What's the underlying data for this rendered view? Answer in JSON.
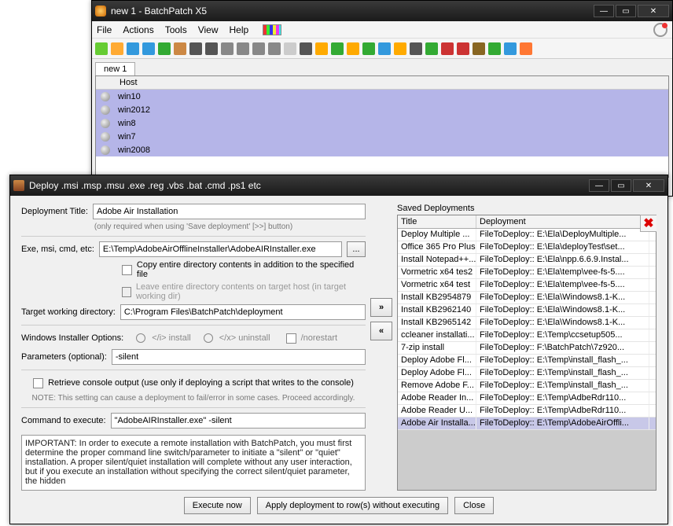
{
  "w1": {
    "title": "new 1 - BatchPatch X5",
    "menu": [
      "File",
      "Actions",
      "Tools",
      "View",
      "Help"
    ],
    "tab": "new 1",
    "gridHeader": "Host",
    "rows": [
      "win10",
      "win2012",
      "win8",
      "win7",
      "win2008"
    ]
  },
  "w2": {
    "title": "Deploy .msi .msp .msu .exe .reg .vbs .bat .cmd .ps1 etc",
    "labels": {
      "depTitle": "Deployment Title:",
      "hint1": "(only required when using 'Save deployment' [>>] button)",
      "exe": "Exe, msi, cmd, etc:",
      "copyDir": "Copy entire directory contents in addition to the specified file",
      "leaveDir": "Leave entire directory contents on target host (in target working dir)",
      "twd": "Target working directory:",
      "wio": "Windows Installer Options:",
      "optInstall": "</i> install",
      "optUninstall": "</x> uninstall",
      "optNorestart": "/norestart",
      "params": "Parameters (optional):",
      "retrieve": "Retrieve console output (use only if deploying a script that writes to the console)",
      "note2": "NOTE: This setting can cause a deployment to fail/error in some cases.  Proceed accordingly.",
      "cmd": "Command to execute:",
      "saved": "Saved Deployments",
      "thTitle": "Title",
      "thDep": "Deployment",
      "execNow": "Execute now",
      "applyRows": "Apply deployment to row(s) without executing",
      "close": "Close",
      "browse": "..."
    },
    "values": {
      "depTitle": "Adobe Air Installation",
      "exe": "E:\\Temp\\AdobeAirOfflineInstaller\\AdobeAIRInstaller.exe",
      "twd": "C:\\Program Files\\BatchPatch\\deployment",
      "params": "-silent",
      "cmd": "\"AdobeAIRInstaller.exe\" -silent"
    },
    "notes": "IMPORTANT: In order to execute a remote installation with BatchPatch, you must first determine the proper command line switch/parameter to initiate a \"silent\" or \"quiet\" installation.\n\nA proper silent/quiet installation will complete without any user interaction, but if you execute an installation without specifying the correct silent/quiet parameter, the hidden",
    "saved": [
      {
        "t": "Deploy Multiple ...",
        "d": "FileToDeploy:: E:\\Ela\\DeployMultiple..."
      },
      {
        "t": "Office 365 Pro Plus",
        "d": "FileToDeploy:: E:\\Ela\\deployTest\\set..."
      },
      {
        "t": "Install Notepad++...",
        "d": "FileToDeploy:: E:\\Ela\\npp.6.6.9.Instal..."
      },
      {
        "t": "Vormetric x64 tes2",
        "d": "FileToDeploy:: E:\\Ela\\temp\\vee-fs-5...."
      },
      {
        "t": "Vormetric x64 test",
        "d": "FileToDeploy:: E:\\Ela\\temp\\vee-fs-5...."
      },
      {
        "t": "Install KB2954879",
        "d": "FileToDeploy:: E:\\Ela\\Windows8.1-K..."
      },
      {
        "t": "Install KB2962140",
        "d": "FileToDeploy:: E:\\Ela\\Windows8.1-K..."
      },
      {
        "t": "Install KB2965142",
        "d": "FileToDeploy:: E:\\Ela\\Windows8.1-K..."
      },
      {
        "t": "ccleaner installati...",
        "d": "FileToDeploy:: E:\\Temp\\ccsetup505..."
      },
      {
        "t": "7-zip install",
        "d": "FileToDeploy:: F:\\BatchPatch\\7z920..."
      },
      {
        "t": "Deploy Adobe Fl...",
        "d": "FileToDeploy:: E:\\Temp\\install_flash_..."
      },
      {
        "t": "Deploy Adobe Fl...",
        "d": "FileToDeploy:: E:\\Temp\\install_flash_..."
      },
      {
        "t": "Remove Adobe F...",
        "d": "FileToDeploy:: E:\\Temp\\install_flash_..."
      },
      {
        "t": "Adobe Reader In...",
        "d": "FileToDeploy:: E:\\Temp\\AdbeRdr110..."
      },
      {
        "t": "Adobe Reader U...",
        "d": "FileToDeploy:: E:\\Temp\\AdbeRdr110..."
      },
      {
        "t": "Adobe Air Installa...",
        "d": "FileToDeploy:: E:\\Temp\\AdobeAirOffli..."
      }
    ]
  },
  "toolbarIcons": [
    "flag-icon",
    "folder-icon",
    "save-icon",
    "copy-icon",
    "plus-icon",
    "network-icon",
    "play-icon",
    "stop-icon",
    "stopwatch-icon",
    "schedule-icon",
    "clock-icon",
    "gear-icon",
    "document-icon",
    "pin-icon",
    "diamond-icon",
    "globe-green-icon",
    "refresh-icon",
    "download-icon",
    "upload-icon",
    "unlock-icon",
    "target-icon",
    "dots-icon",
    "bug-icon",
    "patch-red-icon",
    "patch-brown-icon",
    "patch-green-icon",
    "earth-icon",
    "x-orange-icon"
  ]
}
